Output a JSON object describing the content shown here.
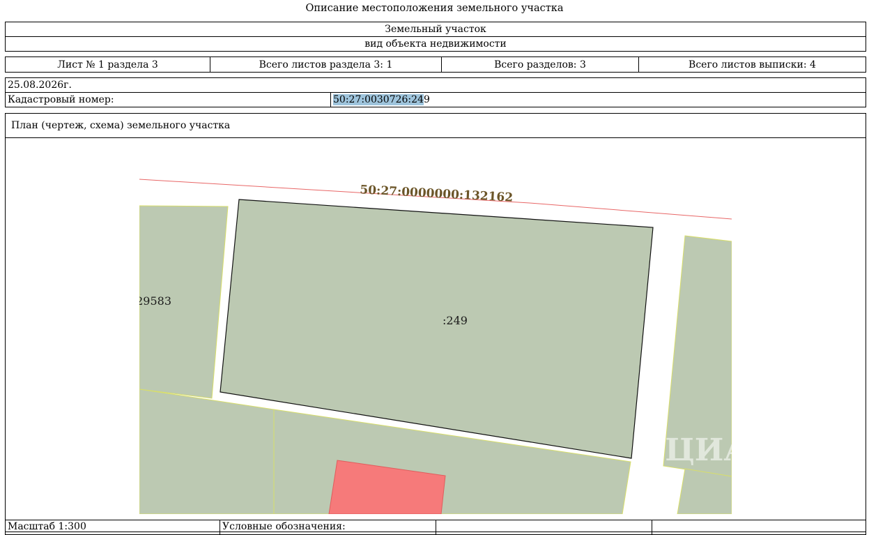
{
  "document": {
    "title": "Описание местоположения земельного участка",
    "object_name": "Земельный участок",
    "object_type": "вид объекта недвижимости",
    "sheet_info": [
      "Лист № 1 раздела 3",
      "Всего листов раздела 3: 1",
      "Всего разделов: 3",
      "Всего листов выписки: 4"
    ],
    "date": "25.08.2026г.",
    "cadastral_label": "Кадастровый номер:",
    "cadastral_number_highlighted": "50:27:0030726:24",
    "cadastral_number_rest": "9",
    "plan_title": "План (чертеж, схема) земельного участка",
    "scale_label": "Масштаб 1:300",
    "legend_label": "Условные обозначения:"
  },
  "map": {
    "road_parcel_label": "50:27:0000000:132162",
    "main_parcel_label": ":249",
    "left_parcel_label": "29583",
    "watermark": "ЦИАН",
    "colors": {
      "parcel_fill": "#bcc9b2",
      "parcel_border_yellow": "#d8de6a",
      "boundary_red": "#e86666",
      "building_fill": "#f67a7a",
      "road_label_color": "#6b5528",
      "highlight": "#9ec4dc"
    }
  }
}
